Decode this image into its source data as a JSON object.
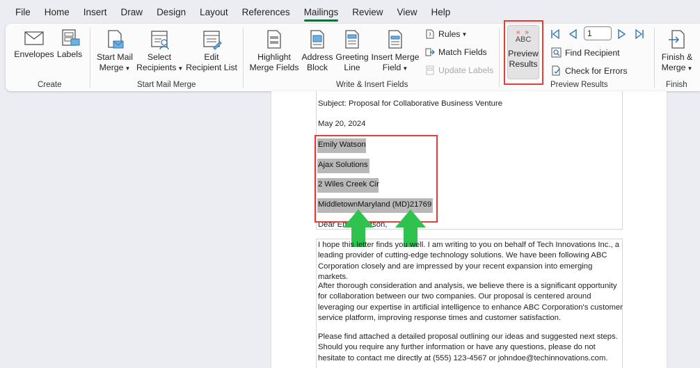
{
  "menu": {
    "tabs": [
      {
        "label": "File"
      },
      {
        "label": "Home"
      },
      {
        "label": "Insert"
      },
      {
        "label": "Draw"
      },
      {
        "label": "Design"
      },
      {
        "label": "Layout"
      },
      {
        "label": "References"
      },
      {
        "label": "Mailings",
        "active": true
      },
      {
        "label": "Review"
      },
      {
        "label": "View"
      },
      {
        "label": "Help"
      }
    ]
  },
  "ribbon": {
    "create": {
      "label": "Create",
      "envelopes": "Envelopes",
      "labels": "Labels"
    },
    "start_mail_merge": {
      "label": "Start Mail Merge",
      "start_line1": "Start Mail",
      "start_line2": "Merge",
      "select_line1": "Select",
      "select_line2": "Recipients",
      "edit_line1": "Edit",
      "edit_line2": "Recipient List"
    },
    "write_insert": {
      "label": "Write & Insert Fields",
      "highlight_line1": "Highlight",
      "highlight_line2": "Merge Fields",
      "address_line1": "Address",
      "address_line2": "Block",
      "greeting_line1": "Greeting",
      "greeting_line2": "Line",
      "insert_line1": "Insert Merge",
      "insert_line2": "Field",
      "rules": "Rules",
      "match_fields": "Match Fields",
      "update_labels": "Update Labels"
    },
    "preview_results": {
      "label": "Preview Results",
      "abc": "ABC",
      "button_line1": "Preview",
      "button_line2": "Results",
      "record_number": "1",
      "find_recipient": "Find Recipient",
      "check_errors": "Check for Errors"
    },
    "finish": {
      "label": "Finish",
      "line1": "Finish &",
      "line2": "Merge"
    }
  },
  "document": {
    "subject": "Subject: Proposal for Collaborative Business Venture",
    "date": "May 20, 2024",
    "recipient_name": "Emily Watson",
    "company": "Ajax Solutions",
    "street": "2 Wiles Creek Cir",
    "city_state_zip": "MiddletownMaryland (MD)21769",
    "greeting": "Dear Emily Watson,",
    "paragraph1": "I hope this letter finds you well. I am writing to you on behalf of Tech Innovations Inc., a leading provider of cutting-edge technology solutions. We have been following ABC Corporation closely and are impressed by your recent expansion into emerging markets.",
    "paragraph2": "After thorough consideration and analysis, we believe there is a significant opportunity for collaboration between our two companies. Our proposal is centered around leveraging our expertise in artificial intelligence to enhance ABC Corporation's customer service platform, improving response times and customer satisfaction.",
    "paragraph3": "Please find attached a detailed proposal outlining our ideas and suggested next steps. Should you require any further information or have any questions, please do not hesitate to contact me directly at (555) 123-4567 or johndoe@techinnovations.com."
  },
  "colors": {
    "annotation_red": "#e63b36",
    "annotation_green": "#2fc24f",
    "active_tab_underline": "#1a6b3c"
  }
}
